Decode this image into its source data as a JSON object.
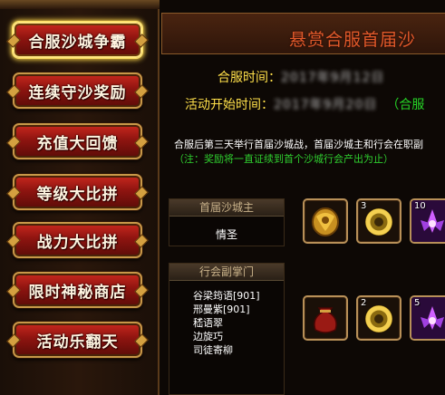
{
  "sidebar": {
    "items": [
      {
        "label": "合服沙城争霸",
        "active": true
      },
      {
        "label": "连续守沙奖励"
      },
      {
        "label": "充值大回馈"
      },
      {
        "label": "等级大比拼"
      },
      {
        "label": "战力大比拼"
      },
      {
        "label": "限时神秘商店"
      },
      {
        "label": "活动乐翻天"
      }
    ]
  },
  "panel": {
    "title": "悬赏合服首届沙",
    "merge_time_label": "合服时间：",
    "merge_time_value": "2017年9月12日",
    "start_time_label": "活动开始时间：",
    "start_time_value": "2017年9月20日",
    "start_time_suffix": "（合服",
    "description": "合服后第三天举行首届沙城战，首届沙城主和行会在职副",
    "note": "（注：奖励将一直证续到首个沙城行会产出为止）"
  },
  "lord_box": {
    "header": "首届沙城主",
    "value": "情圣"
  },
  "deputy_box": {
    "header": "行会副掌门",
    "members": [
      "谷梁筠语[901]",
      "邢曼紫[901]",
      "嵇语翠",
      "边旋巧",
      "司徒寄柳"
    ]
  },
  "rewards": {
    "row1": [
      {
        "icon": "golden-shield-icon",
        "count": ""
      },
      {
        "icon": "gold-ring-icon",
        "count": "3"
      },
      {
        "icon": "purple-lotus-icon",
        "count": "10"
      }
    ],
    "row2": [
      {
        "icon": "red-bag-icon",
        "count": ""
      },
      {
        "icon": "gold-ring-icon",
        "count": "2"
      },
      {
        "icon": "purple-lotus-icon",
        "count": "5"
      }
    ]
  },
  "colors": {
    "title": "#e05a2a",
    "label_yellow": "#ffe04a",
    "green": "#26d426",
    "button_red": "#8e1410",
    "gold_border": "#c89848"
  }
}
